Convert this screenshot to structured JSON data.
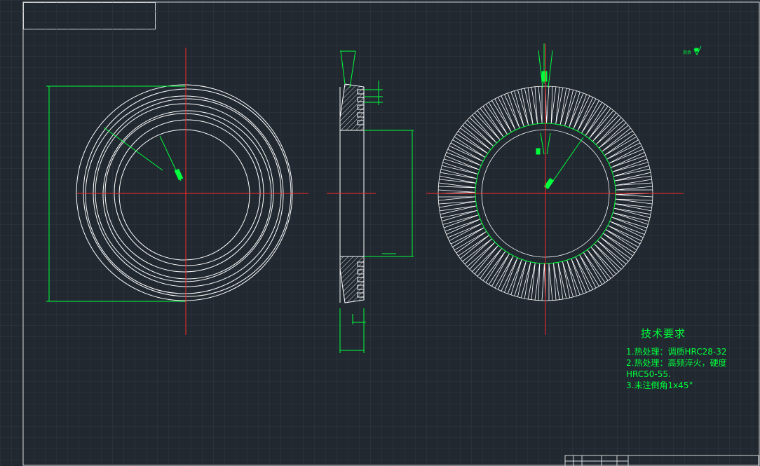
{
  "drawing": {
    "colors": {
      "background": "#212830",
      "grid": "#2f3844",
      "outline": "#ffffff",
      "dimension": "#00ff3c",
      "center_line": "#ff2a2a"
    },
    "technical_requirements": {
      "title": "技术要求",
      "lines": [
        "1.热处理：调质HRC28-32",
        "2.热处理：高频淬火，硬度",
        "HRC50-55.",
        "3.未注倒角1x45°"
      ]
    },
    "roughness_note": "其余"
  }
}
